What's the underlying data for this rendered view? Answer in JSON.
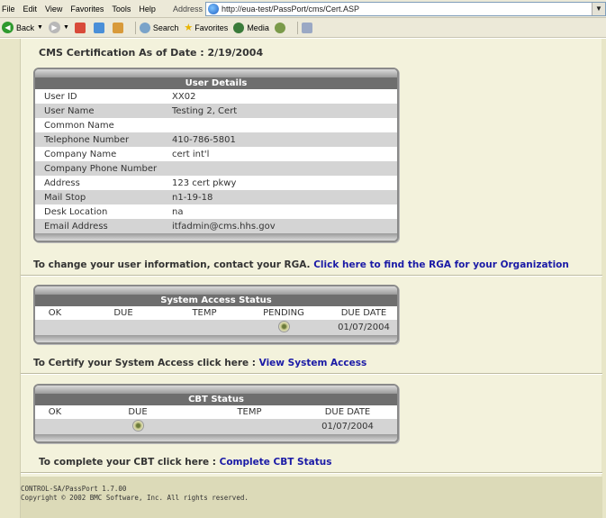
{
  "browser": {
    "menu": [
      "File",
      "Edit",
      "View",
      "Favorites",
      "Tools",
      "Help"
    ],
    "address_label": "Address",
    "address_url": "http://eua-test/PassPort/cms/Cert.ASP",
    "toolbar": {
      "back": "Back",
      "search": "Search",
      "favorites": "Favorites",
      "media": "Media"
    }
  },
  "page": {
    "title": "CMS Certification As of Date : 2/19/2004",
    "user_details": {
      "header": "User Details",
      "rows": [
        {
          "label": "User ID",
          "value": "XX02"
        },
        {
          "label": "User Name",
          "value": "Testing 2, Cert"
        },
        {
          "label": "Common Name",
          "value": ""
        },
        {
          "label": "Telephone Number",
          "value": "410-786-5801"
        },
        {
          "label": "Company Name",
          "value": "cert int'l"
        },
        {
          "label": "Company Phone Number",
          "value": ""
        },
        {
          "label": "Address",
          "value": "123 cert pkwy"
        },
        {
          "label": "Mail Stop",
          "value": "n1-19-18"
        },
        {
          "label": "Desk Location",
          "value": "na"
        },
        {
          "label": "Email Address",
          "value": "itfadmin@cms.hhs.gov"
        }
      ]
    },
    "change_info": {
      "text": "To change your user information, contact your RGA. ",
      "link": "Click here to find the RGA for your Organization"
    },
    "system_access": {
      "header": "System Access Status",
      "columns": [
        "OK",
        "DUE",
        "TEMP",
        "PENDING",
        "DUE DATE"
      ],
      "due_date": "01/07/2004"
    },
    "certify_access": {
      "text": "To Certify your System Access click here : ",
      "link": "View System Access"
    },
    "cbt": {
      "header": "CBT Status",
      "columns": [
        "OK",
        "DUE",
        "TEMP",
        "DUE DATE"
      ],
      "due_date": "01/07/2004"
    },
    "complete_cbt": {
      "text": "To complete your CBT click here : ",
      "link": "Complete CBT Status"
    },
    "footer": {
      "version": "CONTROL-SA/PassPort 1.7.00",
      "copyright": "Copyright © 2002 BMC Software, Inc. All rights reserved."
    }
  }
}
